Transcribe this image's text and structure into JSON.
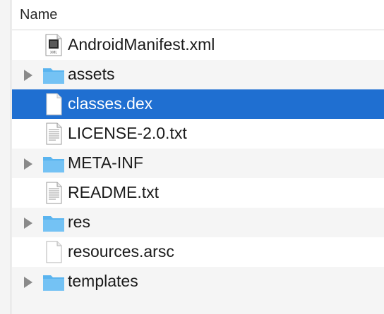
{
  "header": {
    "column_name": "Name"
  },
  "rows": [
    {
      "label": "AndroidManifest.xml",
      "icon": "xml-file-icon",
      "expandable": false,
      "selected": false
    },
    {
      "label": "assets",
      "icon": "folder-icon",
      "expandable": true,
      "selected": false
    },
    {
      "label": "classes.dex",
      "icon": "document-icon",
      "expandable": false,
      "selected": true
    },
    {
      "label": "LICENSE-2.0.txt",
      "icon": "text-file-icon",
      "expandable": false,
      "selected": false
    },
    {
      "label": "META-INF",
      "icon": "folder-icon",
      "expandable": true,
      "selected": false
    },
    {
      "label": "README.txt",
      "icon": "text-file-icon",
      "expandable": false,
      "selected": false
    },
    {
      "label": "res",
      "icon": "folder-icon",
      "expandable": true,
      "selected": false
    },
    {
      "label": "resources.arsc",
      "icon": "document-icon",
      "expandable": false,
      "selected": false
    },
    {
      "label": "templates",
      "icon": "folder-icon",
      "expandable": true,
      "selected": false
    }
  ],
  "colors": {
    "selection": "#1f6fd1",
    "folder": "#5ab4ef",
    "disclosure": "#8a8a8a"
  }
}
